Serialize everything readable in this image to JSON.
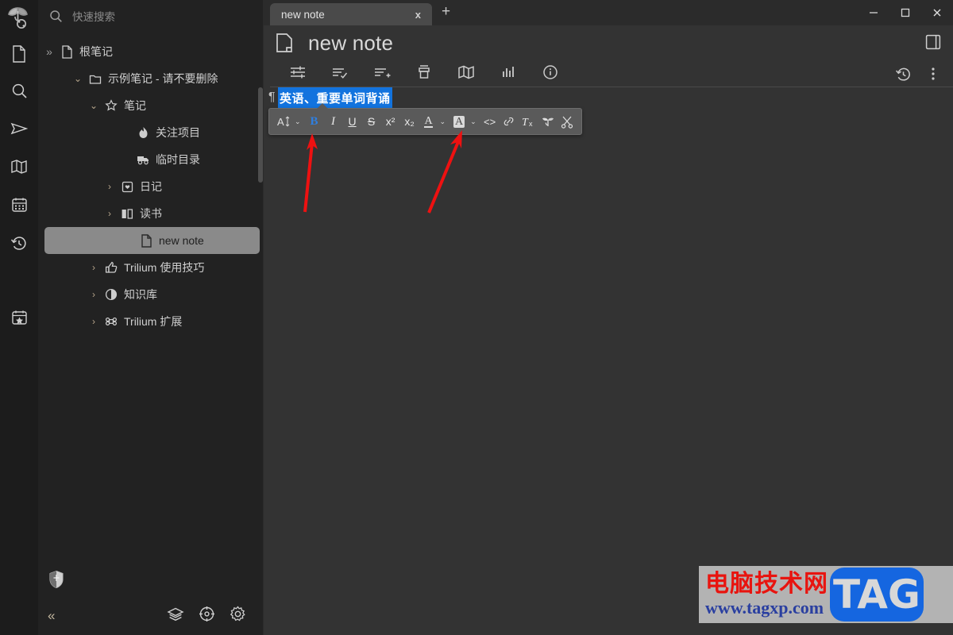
{
  "window": {
    "minimize": "—",
    "maximize": "▢",
    "close": "✕"
  },
  "tabs": {
    "items": [
      {
        "title": "new note",
        "close_label": "x",
        "active": true
      }
    ],
    "new_tab_label": "+"
  },
  "search": {
    "placeholder": "快速搜索",
    "icon": "search-icon"
  },
  "left_rail": {
    "logo": "trilium-logo-icon",
    "items": [
      {
        "icon": "note-file-icon",
        "name": "note-tree"
      },
      {
        "icon": "search-icon",
        "name": "search-notes"
      },
      {
        "icon": "send-icon",
        "name": "jump-to-note"
      },
      {
        "icon": "map-icon",
        "name": "note-map"
      },
      {
        "icon": "calendar-icon",
        "name": "calendar"
      },
      {
        "icon": "recent-history-icon",
        "name": "recent-changes"
      },
      {
        "icon": "calendar-star-icon",
        "name": "today-journal"
      }
    ],
    "shield": "shield-icon"
  },
  "tree": {
    "root": {
      "label": "根笔记",
      "twisty": "»",
      "icon": "note-file-icon"
    },
    "items": [
      {
        "label": "示例笔记 - 请不要删除",
        "twisty": "⌄",
        "icon": "folder-icon",
        "depth": 1,
        "selected": false
      },
      {
        "label": "笔记",
        "twisty": "⌄",
        "icon": "star-icon",
        "depth": 2,
        "selected": false
      },
      {
        "label": "关注项目",
        "twisty": "",
        "icon": "flame-icon",
        "depth": 3,
        "selected": false
      },
      {
        "label": "临时目录",
        "twisty": "",
        "icon": "truck-icon",
        "depth": 3,
        "selected": false
      },
      {
        "label": "日记",
        "twisty": "›",
        "icon": "journal-icon",
        "depth": 2,
        "selected": false
      },
      {
        "label": "读书",
        "twisty": "›",
        "icon": "book-open-icon",
        "depth": 2,
        "selected": false
      },
      {
        "label": "new note",
        "twisty": "",
        "icon": "note-file-icon",
        "depth": 3,
        "selected": true
      },
      {
        "label": "Trilium 使用技巧",
        "twisty": "›",
        "icon": "thumbs-up-icon",
        "depth": 1,
        "selected": false
      },
      {
        "label": "知识库",
        "twisty": "›",
        "icon": "contrast-circle-icon",
        "depth": 1,
        "selected": false
      },
      {
        "label": "Trilium 扩展",
        "twisty": "›",
        "icon": "command-icon",
        "depth": 1,
        "selected": false
      }
    ]
  },
  "sidebar_footer": {
    "collapse_label": "«",
    "buttons": [
      {
        "icon": "layers-icon",
        "name": "layers-button"
      },
      {
        "icon": "target-icon",
        "name": "focus-button"
      },
      {
        "icon": "gear-icon",
        "name": "options-button"
      }
    ]
  },
  "note": {
    "icon": "note-file-icon",
    "title": "new note",
    "right_panel_toggle": "right-panel-icon"
  },
  "ribbon": {
    "tabs": [
      {
        "icon": "sliders-icon",
        "name": "basic-properties"
      },
      {
        "icon": "list-check-icon",
        "name": "owned-attributes"
      },
      {
        "icon": "list-plus-icon",
        "name": "inherited-attributes"
      },
      {
        "icon": "box-icon",
        "name": "note-paths"
      },
      {
        "icon": "map-icon",
        "name": "note-map"
      },
      {
        "icon": "chart-bar-icon",
        "name": "similar-notes"
      },
      {
        "icon": "info-circle-icon",
        "name": "note-info"
      }
    ],
    "right": [
      {
        "icon": "revision-history-icon",
        "name": "note-revisions"
      },
      {
        "icon": "dots-vertical-icon",
        "name": "note-actions-menu"
      }
    ]
  },
  "editor": {
    "paragraph_mark": "¶",
    "selected_text": "英语、重要单词背诵",
    "selection_color": "#1273de"
  },
  "format_toolbar": {
    "buttons": [
      {
        "label": "A",
        "name": "font-size-button",
        "kind": "fontsize",
        "chevron": "⌄",
        "active": false
      },
      {
        "label": "B",
        "name": "bold-button",
        "kind": "bold",
        "active": true
      },
      {
        "label": "I",
        "name": "italic-button",
        "kind": "italic",
        "active": false
      },
      {
        "label": "U",
        "name": "underline-button",
        "kind": "underline",
        "active": false
      },
      {
        "label": "S",
        "name": "strikethrough-button",
        "kind": "strike",
        "active": false
      },
      {
        "label": "x²",
        "name": "superscript-button",
        "kind": "sup",
        "active": false
      },
      {
        "label": "x₂",
        "name": "subscript-button",
        "kind": "sub",
        "active": false
      },
      {
        "label": "A",
        "name": "font-color-button",
        "kind": "fontcolor",
        "chevron": "⌄",
        "active": false
      },
      {
        "label": "A",
        "name": "highlight-button",
        "kind": "highlight",
        "chevron": "⌄",
        "active": false
      },
      {
        "label": "<>",
        "name": "inline-code-button",
        "kind": "code",
        "active": false
      },
      {
        "label": "link",
        "name": "link-button",
        "kind": "link",
        "active": false
      },
      {
        "label": "Tx",
        "name": "remove-format-button",
        "kind": "clearformat",
        "active": false
      },
      {
        "label": "leaf",
        "name": "internal-link-button",
        "kind": "leaf",
        "active": false
      },
      {
        "label": "cut",
        "name": "cut-button",
        "kind": "scissors",
        "active": false
      }
    ],
    "bold_active_color": "#2f7fe0"
  },
  "annotations": {
    "arrow_color": "#ee1111",
    "arrows": [
      {
        "name": "arrow-to-bold-button"
      },
      {
        "name": "arrow-to-font-color-button"
      }
    ]
  },
  "watermark": {
    "cn_text": "电脑技术网",
    "url_text": "www.tagxp.com",
    "badge_text": "TAG"
  }
}
